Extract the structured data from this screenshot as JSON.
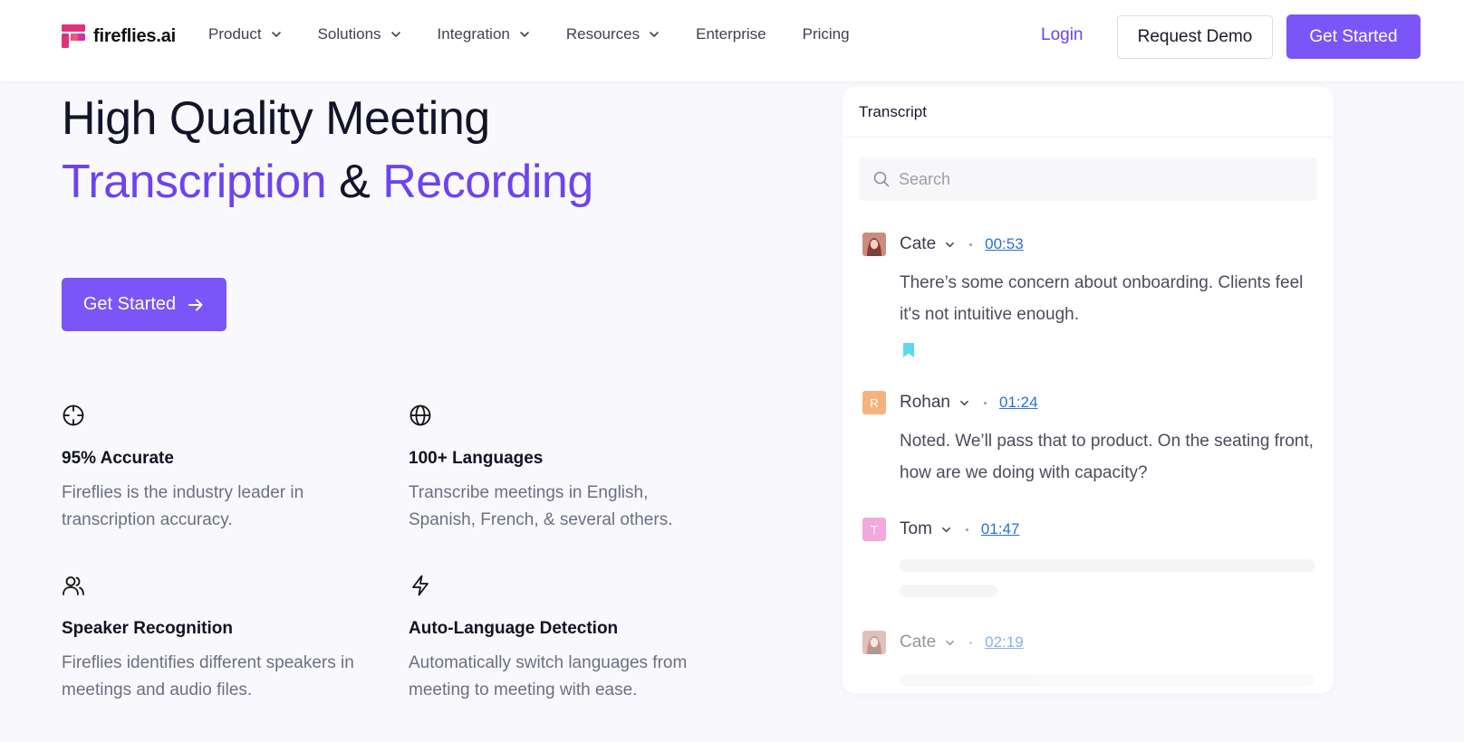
{
  "brand": {
    "name": "fireflies.ai"
  },
  "nav": {
    "items": [
      {
        "label": "Product",
        "dropdown": true
      },
      {
        "label": "Solutions",
        "dropdown": true
      },
      {
        "label": "Integration",
        "dropdown": true
      },
      {
        "label": "Resources",
        "dropdown": true
      },
      {
        "label": "Enterprise",
        "dropdown": false
      },
      {
        "label": "Pricing",
        "dropdown": false
      }
    ],
    "login": "Login",
    "request_demo": "Request Demo",
    "get_started": "Get Started"
  },
  "hero": {
    "line1": "High Quality Meeting",
    "word_transcription": "Transcription",
    "ampersand": "&",
    "word_recording": "Recording",
    "cta": "Get Started"
  },
  "features": [
    {
      "icon": "target-icon",
      "title": "95% Accurate",
      "desc": "Fireflies is the industry leader in transcription accuracy."
    },
    {
      "icon": "globe-icon",
      "title": "100+ Languages",
      "desc": "Transcribe meetings in English, Spanish, French, & several others."
    },
    {
      "icon": "users-icon",
      "title": "Speaker Recognition",
      "desc": "Fireflies identifies different speakers in meetings and audio files."
    },
    {
      "icon": "lightning-icon",
      "title": "Auto-Language Detection",
      "desc": "Automatically switch languages from meeting to meeting with ease."
    }
  ],
  "transcript": {
    "title": "Transcript",
    "search_placeholder": "Search",
    "entries": [
      {
        "speaker": "Cate",
        "time": "00:53",
        "avatar_initial": "",
        "avatar_color": "#b44a4a",
        "text": "There’s some concern about onboarding. Clients feel it's not intuitive enough.",
        "bookmarked": true
      },
      {
        "speaker": "Rohan",
        "time": "01:24",
        "avatar_initial": "R",
        "avatar_color": "#f4b37c",
        "text": "Noted. We’ll pass that to product. On the seating front, how are we doing with capacity?",
        "bookmarked": false
      },
      {
        "speaker": "Tom",
        "time": "01:47",
        "avatar_initial": "T",
        "avatar_color": "#f3a9dd",
        "text": "",
        "bookmarked": false
      },
      {
        "speaker": "Cate",
        "time": "02:19",
        "avatar_initial": "",
        "avatar_color": "#b44a4a",
        "text": "",
        "bookmarked": false
      }
    ]
  },
  "colors": {
    "accent": "#7b55f7",
    "accent_text": "#6e43ef",
    "link": "#2f6fd0",
    "bookmark": "#5fd6f0"
  }
}
